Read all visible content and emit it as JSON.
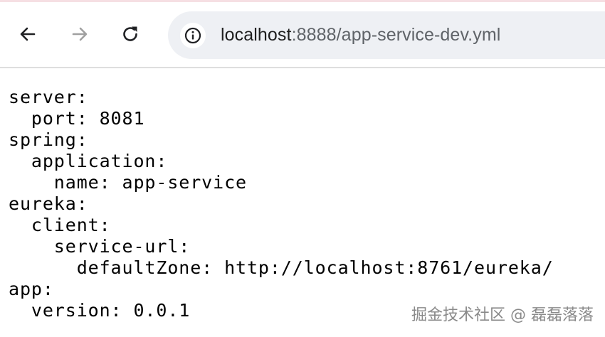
{
  "browser": {
    "url_host": "localhost",
    "url_path": ":8888/app-service-dev.yml"
  },
  "icons": {
    "back": "arrow-left",
    "forward": "arrow-right",
    "reload": "refresh",
    "site_info": "info-circle"
  },
  "colors": {
    "top_accent": "#f6dfe3",
    "omnibox_bg": "#eef0f4",
    "icon_active": "#202124",
    "icon_disabled": "#a0a0a0"
  },
  "document": {
    "lines": [
      "server:",
      "  port: 8081",
      "spring:",
      "  application:",
      "    name: app-service",
      "eureka:",
      "  client:",
      "    service-url:",
      "      defaultZone: http://localhost:8761/eureka/",
      "app:",
      "  version: 0.0.1"
    ]
  },
  "watermark": "掘金技术社区 @ 磊磊落落"
}
